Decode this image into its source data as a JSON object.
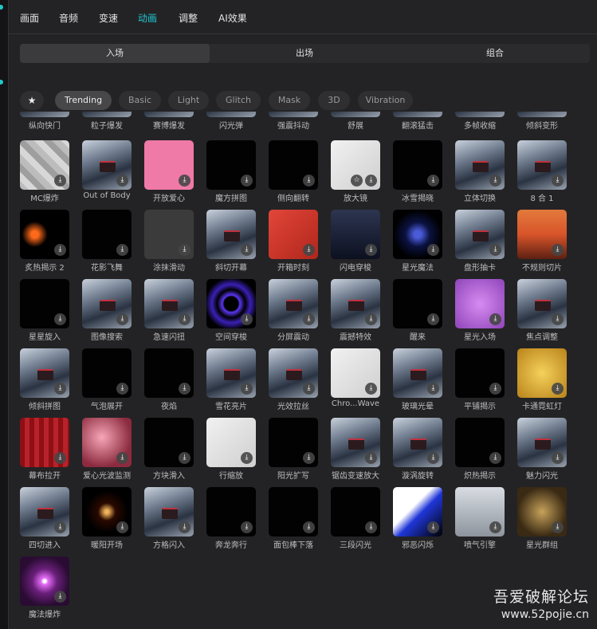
{
  "top_tabs": [
    "画面",
    "音频",
    "变速",
    "动画",
    "调整",
    "AI效果"
  ],
  "active_top_tab": "动画",
  "sub_tabs": [
    "入场",
    "出场",
    "组合"
  ],
  "active_sub_tab": "入场",
  "filter_chips": {
    "favorite_icon": "star-icon",
    "labels": [
      "Trending",
      "Basic",
      "Light",
      "Glitch",
      "Mask",
      "3D",
      "Vibration"
    ],
    "active": "Trending"
  },
  "row0_labels": [
    "纵向快门",
    "粒子爆发",
    "赛博爆发",
    "闪光弹",
    "强震抖动",
    "舒展",
    "翻滚猛击",
    "多帧收缩",
    "倾斜变形"
  ],
  "grid": [
    [
      "MC爆炸",
      "Out of Body",
      "开放爱心",
      "魔方拼图",
      "侧向翻转",
      "放大镜",
      "冰雪揭晓",
      "立体切换",
      "8 合 1"
    ],
    [
      "炙热揭示 2",
      "花影飞舞",
      "涂抹滑动",
      "斜切开幕",
      "开箱时刻",
      "闪电穿梭",
      "星光魔法",
      "盘形抽卡",
      "不规则切片"
    ],
    [
      "星星旋入",
      "图像搜索",
      "急速闪扭",
      "空间穿梭",
      "分屏震动",
      "震撼特效",
      "醒来",
      "星光入场",
      "焦点调整"
    ],
    [
      "倾斜拼图",
      "气泡展开",
      "夜焰",
      "雪花亮片",
      "光效拉丝",
      "Chro...Wave",
      "玻璃光晕",
      "平铺揭示",
      "卡通霓虹灯"
    ],
    [
      "幕布拉开",
      "爱心光波监测",
      "方块滑入",
      "行缩放",
      "阳光扩写",
      "锯齿变速放大",
      "漩涡旋转",
      "炽热揭示",
      "魅力闪光"
    ],
    [
      "四切进入",
      "暖阳开场",
      "方格闪入",
      "奔龙奔行",
      "面包棒下落",
      "三段闪光",
      "邪恶闪烁",
      "喷气引擎",
      "星光群组"
    ],
    [
      "魔法爆炸"
    ]
  ],
  "watermark": {
    "line1": "吾爱破解论坛",
    "line2": "www.52pojie.cn"
  }
}
